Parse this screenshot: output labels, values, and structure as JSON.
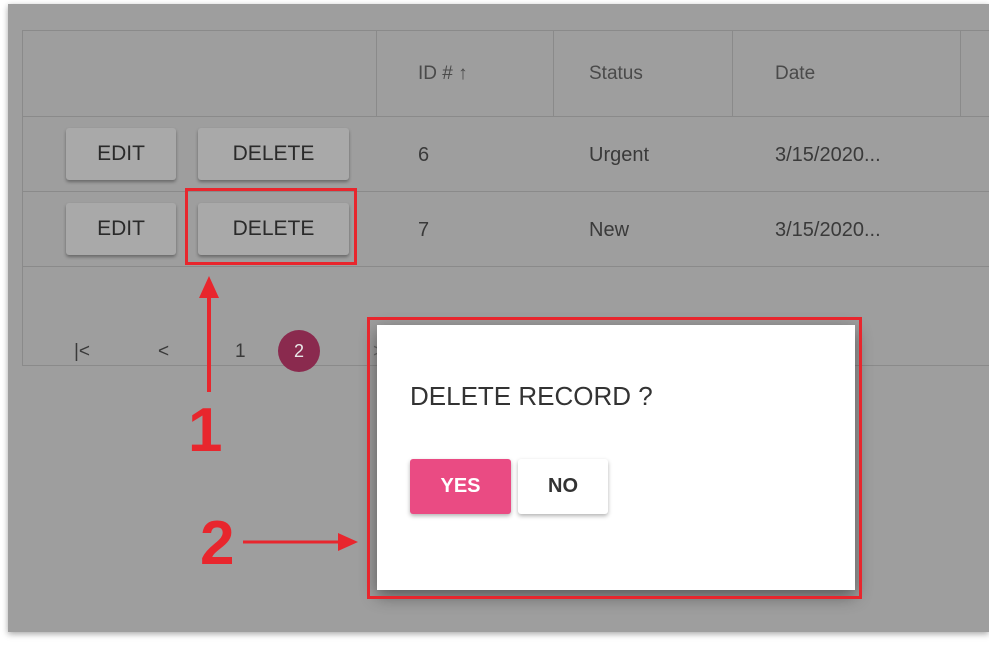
{
  "table": {
    "columns": [
      "ID # ↑",
      "Status",
      "Date"
    ],
    "rows": [
      {
        "edit_label": "EDIT",
        "delete_label": "DELETE",
        "id": "6",
        "status": "Urgent",
        "date": "3/15/2020..."
      },
      {
        "edit_label": "EDIT",
        "delete_label": "DELETE",
        "id": "7",
        "status": "New",
        "date": "3/15/2020..."
      }
    ]
  },
  "pager": {
    "first": "|<",
    "prev": "<",
    "pages": [
      "1",
      "2"
    ],
    "active_page": "2",
    "next": ">",
    "last": ">|"
  },
  "dialog": {
    "title": "DELETE RECORD ?",
    "yes_label": "YES",
    "no_label": "NO"
  },
  "annotations": {
    "step1": "1",
    "step2": "2",
    "color": "#e8262d"
  },
  "colors": {
    "accent": "#ea4b83",
    "active_page": "#8a2a4e",
    "overlay": "#9e9e9e"
  }
}
